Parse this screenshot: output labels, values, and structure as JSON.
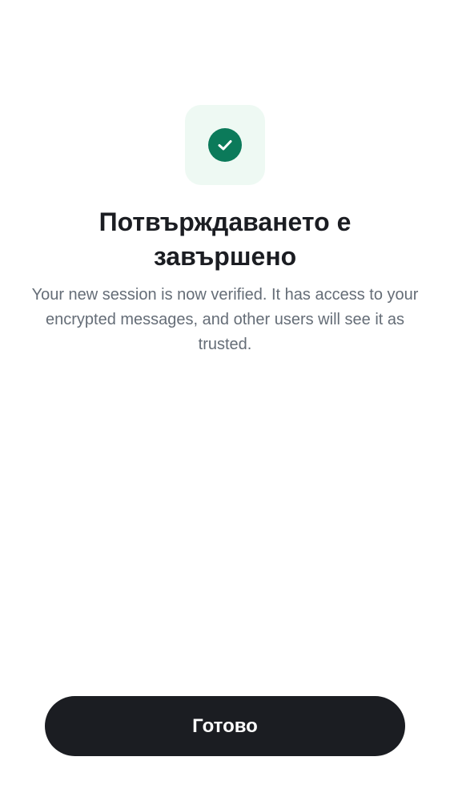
{
  "verification": {
    "title": "Потвърждаването е завършено",
    "description": "Your new session is now verified. It has access to your encrypted messages, and other users will see it as trusted.",
    "icon": "check-circle-icon"
  },
  "actions": {
    "done_label": "Готово"
  },
  "colors": {
    "accent": "#0b7a5a",
    "icon_background": "#eef9f3",
    "button_background": "#1b1d22",
    "button_text": "#ffffff",
    "title_text": "#1b1d22",
    "body_text": "#656d77"
  }
}
